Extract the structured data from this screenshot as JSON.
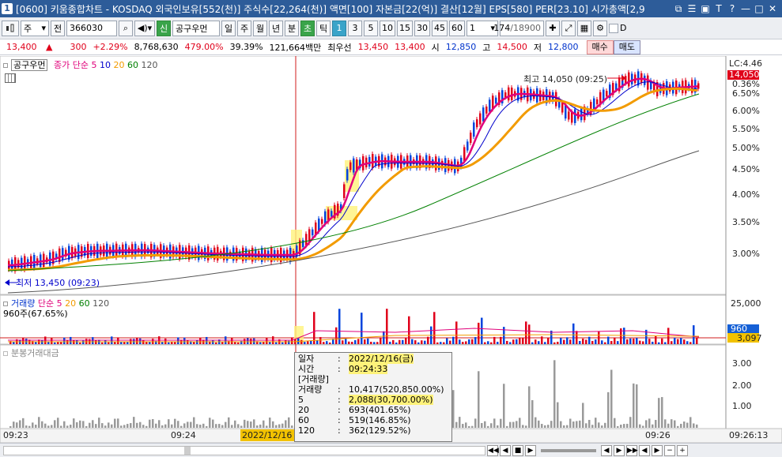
{
  "window": {
    "number": "1",
    "title": "[0600] 키움종합차트 - KOSDAQ 외국인보유[552(천)] 주식수[22,264(천)] 액면[100] 자본금[22(억)] 결산[12월] EPS[580] PER[23.10] 시가총액[2,9",
    "buttons": [
      "⧉",
      "☰",
      "▣",
      "T",
      "?",
      "—",
      "□",
      "✕"
    ]
  },
  "toolbar": {
    "type_label": "주",
    "full_label": "전",
    "code_value": "366030",
    "search_icon": "search-icon",
    "sound_icon": "speaker-icon",
    "credit_label": "신",
    "stock_name": "공구우먼",
    "periods": [
      "일",
      "주",
      "월",
      "년",
      "분",
      "초",
      "틱"
    ],
    "active_period": "분",
    "intervals": [
      "1",
      "3",
      "5",
      "10",
      "15",
      "30",
      "45",
      "60"
    ],
    "active_interval": "1",
    "unit_value": "1",
    "count_value": "174",
    "count_total": "/18900",
    "checkbox_label": "D"
  },
  "info": {
    "price": "13,400",
    "change_arrow": "▲",
    "change": "300",
    "change_pct": "+2.29%",
    "volume": "8,768,630",
    "volume_ratio": "479.00%",
    "turnover": "39.39%",
    "amount": "121,664백만",
    "bid_label": "최우선",
    "ask": "13,450",
    "bid": "13,400",
    "open_label": "시",
    "open": "12,850",
    "high_label": "고",
    "high": "14,500",
    "low_label": "저",
    "low": "12,800",
    "buy_button": "매수",
    "sell_button": "매도"
  },
  "price_pane": {
    "legend_name": "공구우먼",
    "legend_ma": "종가 단순 5",
    "ma_periods": [
      "10",
      "20",
      "60",
      "120"
    ],
    "ma_colors": [
      "#e0007a",
      "#0000cc",
      "#f29b00",
      "#008000",
      "#555555"
    ],
    "high_annotation": "최고 14,050 (09:25)",
    "low_annotation": "최저 13,450 (09:23)",
    "lc_label": "LC:4.46",
    "current_tag": "14,050",
    "current_pct": "0.36%",
    "y_ticks": [
      "6.50%",
      "6.00%",
      "5.50%",
      "5.00%",
      "4.50%",
      "4.00%",
      "3.50%",
      "3.00%"
    ]
  },
  "volume_pane": {
    "legend_name": "거래량",
    "legend_ma": "단순 5",
    "ma_periods": [
      "20",
      "60",
      "120"
    ],
    "sub_label": "960주(67.65%)",
    "y_ticks": [
      "25,000"
    ],
    "tag_last": "960",
    "tag_avg": "3,097"
  },
  "amount_pane": {
    "legend_name": "분봉거래대금",
    "y_ticks": [
      "3.00",
      "2.00",
      "1.00"
    ]
  },
  "x_axis": {
    "labels": [
      "09:23",
      "09:24",
      "2022/12/16",
      "09:26",
      "09:26:13"
    ]
  },
  "tooltip": {
    "rows": [
      {
        "k": "일자",
        "v": "2022/12/16(금)"
      },
      {
        "k": "시간",
        "v": "09:24:33"
      },
      {
        "k": "[거래량]",
        "v": ""
      },
      {
        "k": " 거래량",
        "v": "10,417(520,850.00%)"
      },
      {
        "k": " 5",
        "v": "2,088(30,700.00%)"
      },
      {
        "k": " 20",
        "v": "693(401.65%)"
      },
      {
        "k": " 60",
        "v": "519(146.85%)"
      },
      {
        "k": " 120",
        "v": "362(129.52%)"
      }
    ]
  },
  "bottom": {
    "buttons": [
      "◀◀",
      "◀",
      "■",
      "▶",
      "◀",
      "▶",
      "▶▶",
      "◀",
      "▶",
      "−",
      "+"
    ]
  }
}
